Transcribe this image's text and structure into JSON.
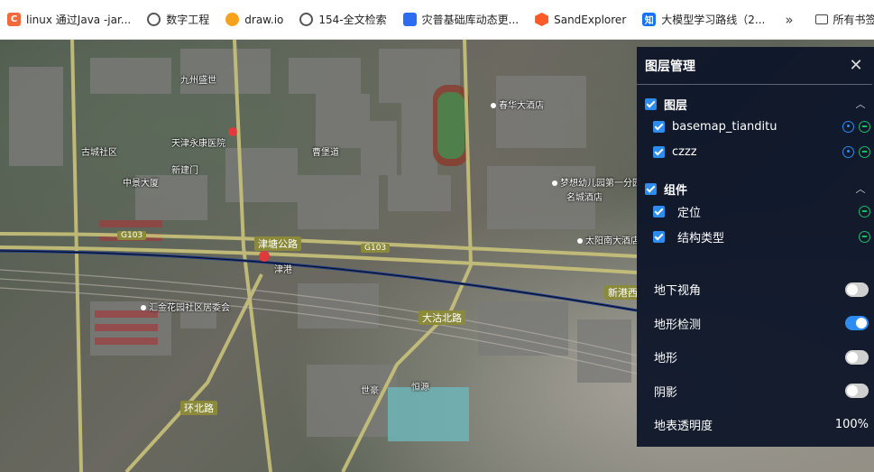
{
  "bookmarks": [
    {
      "label": "linux 通过Java -jar...",
      "icon": "csdn-icon"
    },
    {
      "label": "数字工程",
      "icon": "globe-icon"
    },
    {
      "label": "draw.io",
      "icon": "drawio-icon"
    },
    {
      "label": "154-全文检索",
      "icon": "globe-icon"
    },
    {
      "label": "灾普基础库动态更...",
      "icon": "blue-bookmark-icon"
    },
    {
      "label": "SandExplorer",
      "icon": "sand-explorer-icon"
    },
    {
      "label": "大模型学习路线（2...",
      "icon": "zhihu-icon"
    }
  ],
  "bookmarks_more": "»",
  "bookmarks_folder": "所有书签",
  "map_labels": {
    "jiuzhou": "九州盛世",
    "yonglong": "天津永康医院",
    "gucheng": "古城社区",
    "zhongjing": "中景大厦",
    "xinjian": "新建门",
    "caowu": "曹堡道",
    "jinhuai": "津塘公路",
    "g103a": "G103",
    "g103b": "G103",
    "chunhua": "春华大酒店",
    "xinggang": "新港西",
    "jingang": "津港",
    "dagubei": "大沽北路",
    "kindergarten": "梦想幼儿园第一分园",
    "mingcheng": "名城酒店",
    "taiyang": "太阳南大酒店",
    "huijin": "汇金花园社区居委会",
    "huanbei": "环北路",
    "shihao": "世豪",
    "hengyuan": "恒源"
  },
  "panel": {
    "title": "图层管理",
    "close": "✕",
    "layers_section": {
      "title": "图层",
      "caret": "︿",
      "items": [
        {
          "label": "basemap_tianditu"
        },
        {
          "label": "czzz"
        }
      ]
    },
    "components_section": {
      "title": "组件",
      "caret": "︿",
      "items": [
        {
          "label": "定位"
        },
        {
          "label": "结构类型"
        }
      ]
    },
    "options": [
      {
        "label": "地下视角",
        "on": false
      },
      {
        "label": "地形检测",
        "on": true
      },
      {
        "label": "地形",
        "on": false
      },
      {
        "label": "阴影",
        "on": false
      }
    ],
    "opacity": {
      "label": "地表透明度",
      "value": "100%"
    }
  },
  "colors": {
    "panel_bg": "#0c1428",
    "checkbox": "#2d8cf0",
    "remove_button": "#19be6b",
    "toggle_on": "#2d8cf0",
    "toggle_off": "#cfcfcf"
  }
}
